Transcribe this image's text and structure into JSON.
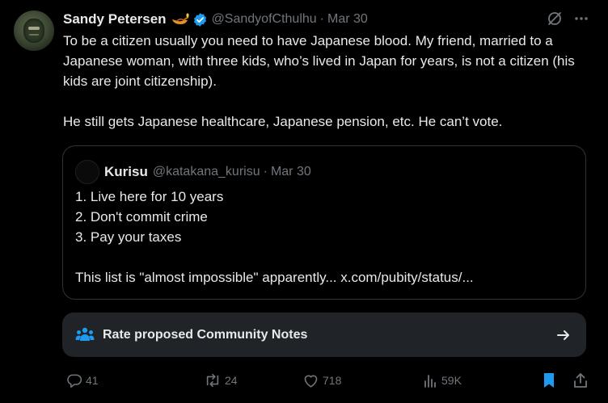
{
  "author": {
    "name": "Sandy Petersen",
    "handle": "@SandyofCthulhu",
    "separator": "·",
    "date": "Mar 30",
    "avatar_icon": "cthulhu-avatar",
    "badge_icon": "verified-badge-icon",
    "emoji_icon": "oil-lamp-emoji"
  },
  "tweet": {
    "paragraphs": [
      "To be a citizen usually you need to have Japanese blood. My friend, married to a Japanese woman, with three kids, who’s lived in Japan for years, is not a citizen (his kids are joint citizenship).",
      "He still gets Japanese healthcare, Japanese pension, etc. He can’t vote."
    ]
  },
  "quote": {
    "name": "Kurisu",
    "handle": "@katakana_kurisu",
    "separator": "·",
    "date": "Mar 30",
    "lines": [
      "1. Live here for 10 years",
      "2. Don't commit crime",
      "3. Pay your taxes"
    ],
    "closing": "This list is \"almost impossible\" apparently... x.com/pubity/status/..."
  },
  "community_notes": {
    "label": "Rate proposed Community Notes",
    "icon": "community-notes-icon",
    "arrow_icon": "arrow-right-icon"
  },
  "actions": {
    "replies": "41",
    "reposts": "24",
    "likes": "718",
    "views": "59K"
  },
  "colors": {
    "background": "#000000",
    "text": "#e7e9ea",
    "muted": "#71767b",
    "accent": "#1d9bf0",
    "border": "#2f3336",
    "cn_bar": "#202327"
  }
}
